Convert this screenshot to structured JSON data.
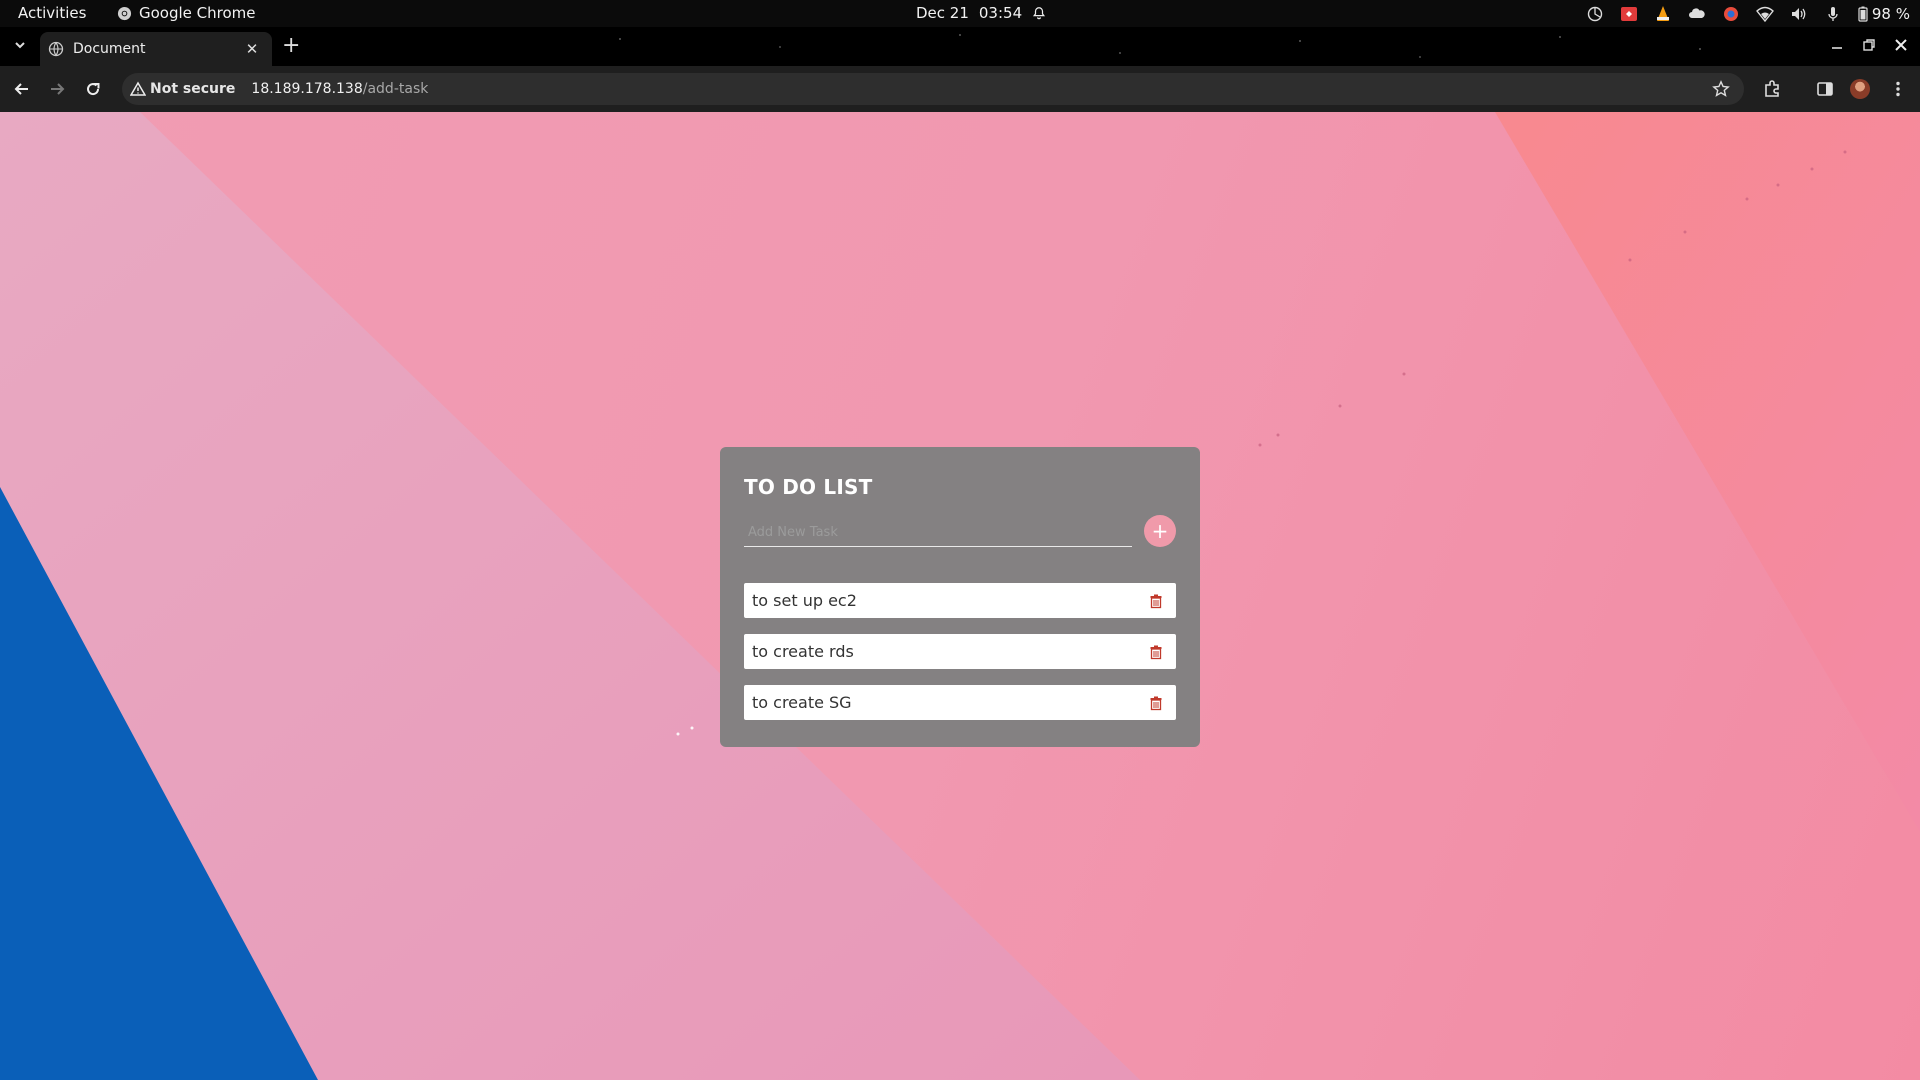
{
  "system_bar": {
    "activities": "Activities",
    "app_name": "Google Chrome",
    "date": "Dec 21",
    "time": "03:54",
    "battery": "98 %"
  },
  "browser": {
    "tab_title": "Document",
    "security_label": "Not secure",
    "url_host": "18.189.178.138",
    "url_path": "/add-task"
  },
  "todo": {
    "title": "TO DO LIST",
    "input_placeholder": "Add New Task",
    "input_value": "",
    "add_label": "+",
    "tasks": [
      {
        "text": "to set up ec2"
      },
      {
        "text": "to create rds"
      },
      {
        "text": "to create SG"
      }
    ]
  },
  "colors": {
    "card": "#808080",
    "accent": "#f09aaa",
    "delete_icon": "#c0392b",
    "wallpaper_blue": "#0a5fb8"
  }
}
